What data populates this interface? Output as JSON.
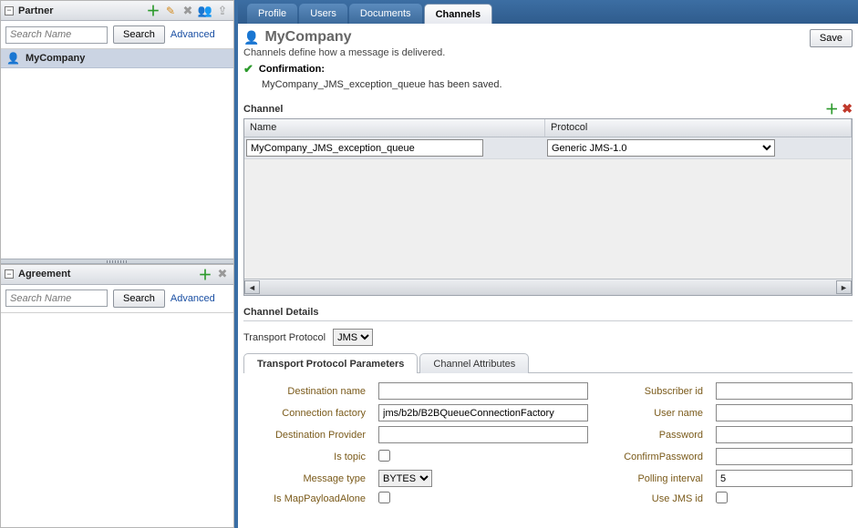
{
  "sidebar": {
    "partner": {
      "title": "Partner",
      "search_placeholder": "Search Name",
      "search_btn": "Search",
      "advanced": "Advanced",
      "items": [
        {
          "label": "MyCompany"
        }
      ]
    },
    "agreement": {
      "title": "Agreement",
      "search_placeholder": "Search Name",
      "search_btn": "Search",
      "advanced": "Advanced"
    }
  },
  "tabs": [
    "Profile",
    "Users",
    "Documents",
    "Channels"
  ],
  "active_tab": "Channels",
  "page": {
    "title": "MyCompany",
    "save": "Save",
    "subtext": "Channels define how a message is delivered.",
    "confirmation_label": "Confirmation:",
    "confirmation_msg": "MyCompany_JMS_exception_queue has been saved."
  },
  "channel_section": {
    "label": "Channel",
    "col_name": "Name",
    "col_protocol": "Protocol",
    "row": {
      "name": "MyCompany_JMS_exception_queue",
      "protocol": "Generic JMS-1.0"
    }
  },
  "details": {
    "title": "Channel Details",
    "transport_protocol_label": "Transport Protocol",
    "transport_protocol_value": "JMS",
    "tabs": [
      "Transport Protocol Parameters",
      "Channel Attributes"
    ],
    "fields": {
      "destination_name_label": "Destination name",
      "destination_name_value": "",
      "connection_factory_label": "Connection factory",
      "connection_factory_value": "jms/b2b/B2BQueueConnectionFactory",
      "destination_provider_label": "Destination Provider",
      "destination_provider_value": "",
      "is_topic_label": "Is topic",
      "message_type_label": "Message type",
      "message_type_value": "BYTES",
      "is_map_label": "Is MapPayloadAlone",
      "subscriber_id_label": "Subscriber id",
      "subscriber_id_value": "",
      "user_name_label": "User name",
      "user_name_value": "",
      "password_label": "Password",
      "password_value": "",
      "confirm_password_label": "ConfirmPassword",
      "confirm_password_value": "",
      "polling_interval_label": "Polling interval",
      "polling_interval_value": "5",
      "use_jms_id_label": "Use JMS id"
    }
  }
}
